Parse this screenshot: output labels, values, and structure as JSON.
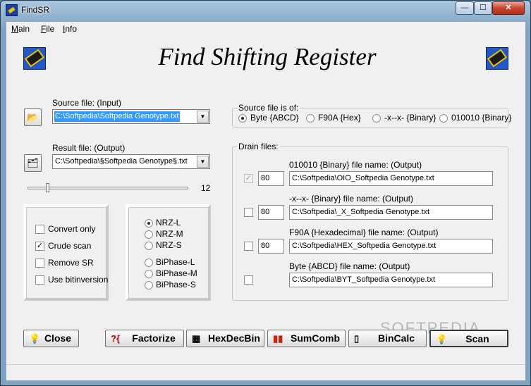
{
  "window": {
    "title": "FindSR",
    "controls": {
      "minimize": "—",
      "maximize": "☐",
      "close": "✕"
    }
  },
  "menu": {
    "items": [
      "Main",
      "File",
      "Info"
    ]
  },
  "header": {
    "title": "Find Shifting Register"
  },
  "source": {
    "label": "Source file: (Input)",
    "value": "C:\\Softpedia\\Softpedia Genotype.txt",
    "open_icon": "folder-open-icon"
  },
  "result": {
    "label": "Result file: (Output)",
    "value": "C:\\Softpedia\\§Softpedia Genotype§.txt",
    "save_icon": "folder-save-icon"
  },
  "slider": {
    "value": "12",
    "fraction": 0.12
  },
  "options": {
    "checkboxes": [
      {
        "label": "Convert only",
        "checked": false
      },
      {
        "label": "Crude scan",
        "checked": true
      },
      {
        "label": "Remove SR",
        "checked": false
      },
      {
        "label": "Use bitinversion",
        "checked": false
      }
    ]
  },
  "encoding": {
    "radios": [
      {
        "label": "NRZ-L",
        "selected": true
      },
      {
        "label": "NRZ-M",
        "selected": false
      },
      {
        "label": "NRZ-S",
        "selected": false
      },
      {
        "label": "BiPhase-L",
        "selected": false
      },
      {
        "label": "BiPhase-M",
        "selected": false
      },
      {
        "label": "BiPhase-S",
        "selected": false
      }
    ]
  },
  "source_type": {
    "title": "Source file is of:",
    "options": [
      {
        "label": "Byte {ABCD}",
        "selected": true
      },
      {
        "label": "F90A {Hex}",
        "selected": false
      },
      {
        "label": "-x--x- {Binary}",
        "selected": false
      },
      {
        "label": "010010 {Binary}",
        "selected": false
      }
    ]
  },
  "drain": {
    "title": "Drain files:",
    "rows": [
      {
        "label": "010010 {Binary} file name: (Output)",
        "checked": true,
        "disabled": true,
        "count": "80",
        "path": "C:\\Softpedia\\OIO_Softpedia Genotype.txt"
      },
      {
        "label": "-x--x- {Binary} file name: (Output)",
        "checked": false,
        "disabled": false,
        "count": "80",
        "path": "C:\\Softpedia\\_X_Softpedia Genotype.txt"
      },
      {
        "label": "F90A {Hexadecimal} file name: (Output)",
        "checked": false,
        "disabled": false,
        "count": "80",
        "path": "C:\\Softpedia\\HEX_Softpedia Genotype.txt"
      },
      {
        "label": "Byte {ABCD} file name: (Output)",
        "checked": false,
        "disabled": false,
        "count": "",
        "path": "C:\\Softpedia\\BYT_Softpedia Genotype.txt"
      }
    ]
  },
  "buttons": {
    "close": {
      "label": "Close",
      "icon": "lightbulb-icon",
      "glyph": "💡"
    },
    "factorize": {
      "label": "Factorize",
      "icon": "factorize-icon",
      "glyph": "?{"
    },
    "hexdecbin": {
      "label": "HexDecBin",
      "icon": "calculator-icon",
      "glyph": "▦"
    },
    "sumcomb": {
      "label": "SumComb",
      "icon": "bars-icon",
      "glyph": "▮▮"
    },
    "bincalc": {
      "label": "BinCalc",
      "icon": "pocket-calculator-icon",
      "glyph": "▯"
    },
    "scan": {
      "label": "Scan",
      "icon": "lightbulb-on-icon",
      "glyph": "💡"
    }
  },
  "watermark": "SOFTPEDIA",
  "colors": {
    "selection": "#3399ff",
    "close_button": "#c6452d"
  }
}
